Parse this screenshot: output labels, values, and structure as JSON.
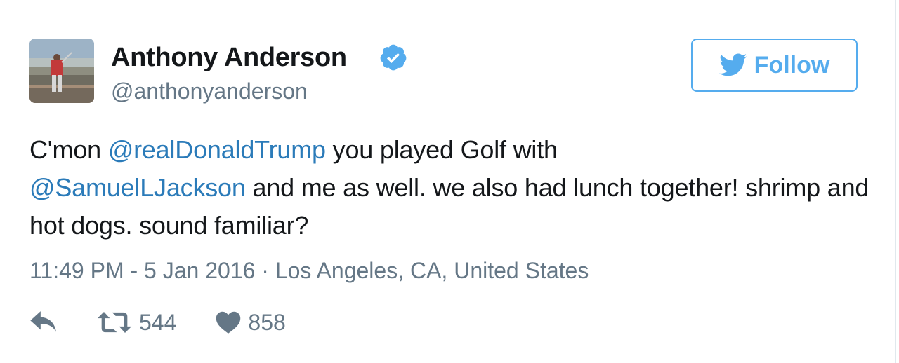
{
  "user": {
    "display_name": "Anthony Anderson",
    "handle": "@anthonyanderson",
    "verified": true,
    "verified_icon": "verified-badge-icon"
  },
  "follow_button": {
    "label": "Follow",
    "icon": "twitter-bird-icon"
  },
  "tweet": {
    "segments": [
      {
        "text": "C'mon ",
        "mention": false
      },
      {
        "text": "@realDonaldTrump",
        "mention": true
      },
      {
        "text": " you played Golf with ",
        "mention": false
      },
      {
        "text": "@SamuelLJackson",
        "mention": true
      },
      {
        "text": " and me as well. we also had lunch together! shrimp and hot dogs. sound familiar?",
        "mention": false
      }
    ],
    "timestamp_location": "11:49 PM - 5 Jan 2016 · Los Angeles, CA, United States"
  },
  "actions": {
    "reply_icon": "reply-icon",
    "retweet_icon": "retweet-icon",
    "retweet_count": "544",
    "like_icon": "heart-icon",
    "like_count": "858"
  },
  "colors": {
    "link": "#2b7bb9",
    "accent": "#55acee",
    "muted": "#657786",
    "text": "#14171a"
  }
}
